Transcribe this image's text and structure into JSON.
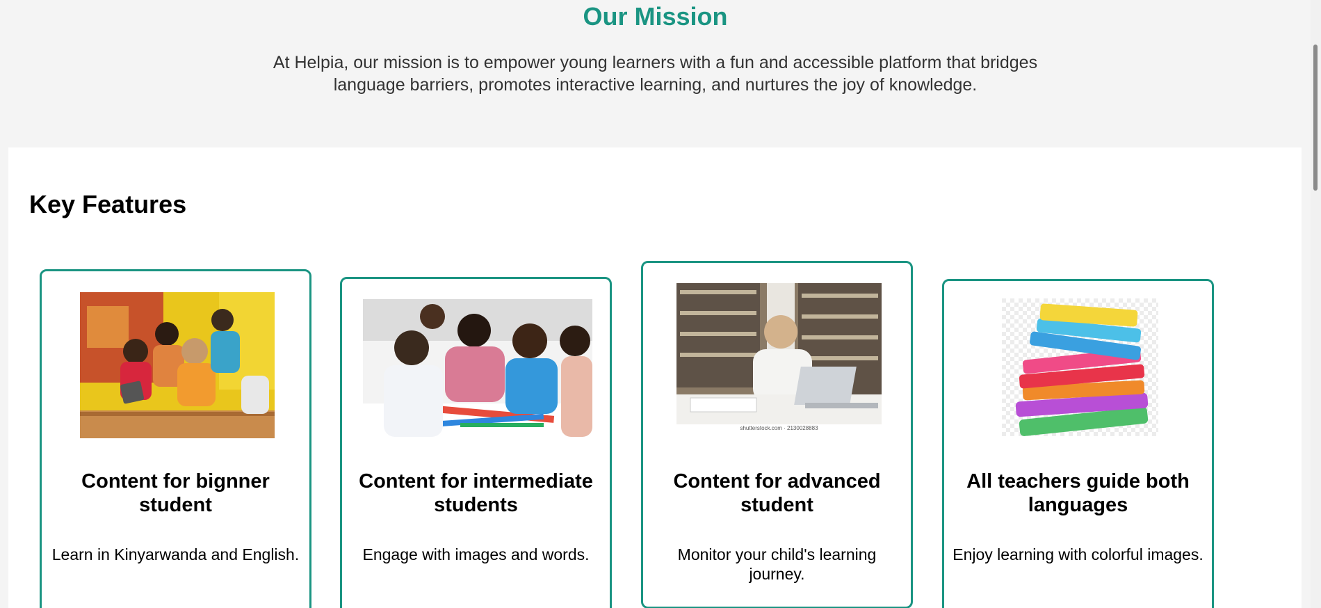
{
  "mission": {
    "title": "Our Mission",
    "text": "At Helpia, our mission is to empower young learners with a fun and accessible platform that bridges language barriers, promotes interactive learning, and nurtures the joy of knowledge."
  },
  "features": {
    "title": "Key Features",
    "cards": [
      {
        "title": "Content for bignner student",
        "description": "Learn in Kinyarwanda and English.",
        "image_icon": "children-with-tablet-image"
      },
      {
        "title": "Content for intermediate students",
        "description": "Engage with images and words.",
        "image_icon": "children-drawing-image"
      },
      {
        "title": "Content for advanced student",
        "description": "Monitor your child's learning journey.",
        "image_icon": "student-studying-library-image",
        "image_caption": "shutterstock.com · 2130028883"
      },
      {
        "title": "All teachers guide both languages",
        "description": "Enjoy learning with colorful images.",
        "image_icon": "stack-of-books-image"
      }
    ]
  },
  "colors": {
    "accent": "#1a9482",
    "page_background": "#f4f4f4",
    "section_background": "#ffffff"
  }
}
